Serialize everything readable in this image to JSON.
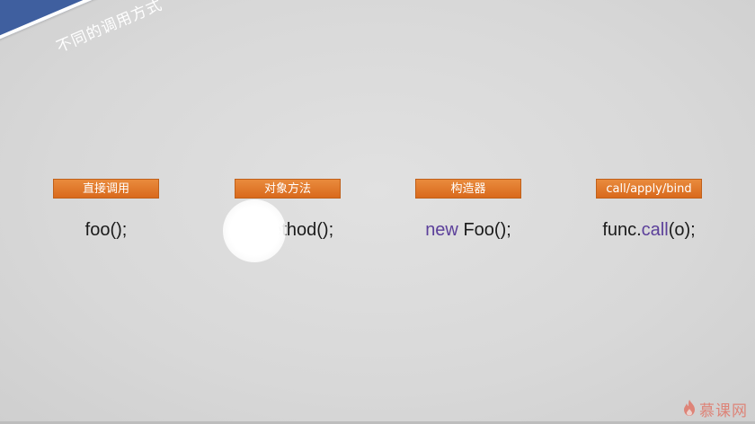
{
  "slide": {
    "title": "不同的调用方式",
    "banner_color": "#3f5f9f",
    "tag_color": "#e37b2e",
    "keyword_color": "#5b3f9a"
  },
  "columns": [
    {
      "tag": "直接调用",
      "code_pre": "",
      "code_kw": "",
      "code_mid": "foo();",
      "code_kw2": "",
      "code_post": ""
    },
    {
      "tag": "对象方法",
      "code_pre": "",
      "code_kw": "",
      "code_mid": "o.method();",
      "code_kw2": "",
      "code_post": ""
    },
    {
      "tag": "构造器",
      "code_pre": "",
      "code_kw": "new",
      "code_mid": " Foo();",
      "code_kw2": "",
      "code_post": ""
    },
    {
      "tag": "call/apply/bind",
      "code_pre": "func.",
      "code_kw": "",
      "code_mid": "",
      "code_kw2": "call",
      "code_post": "(o);"
    }
  ],
  "watermark": {
    "text": "慕课网",
    "icon": "flame-icon"
  }
}
